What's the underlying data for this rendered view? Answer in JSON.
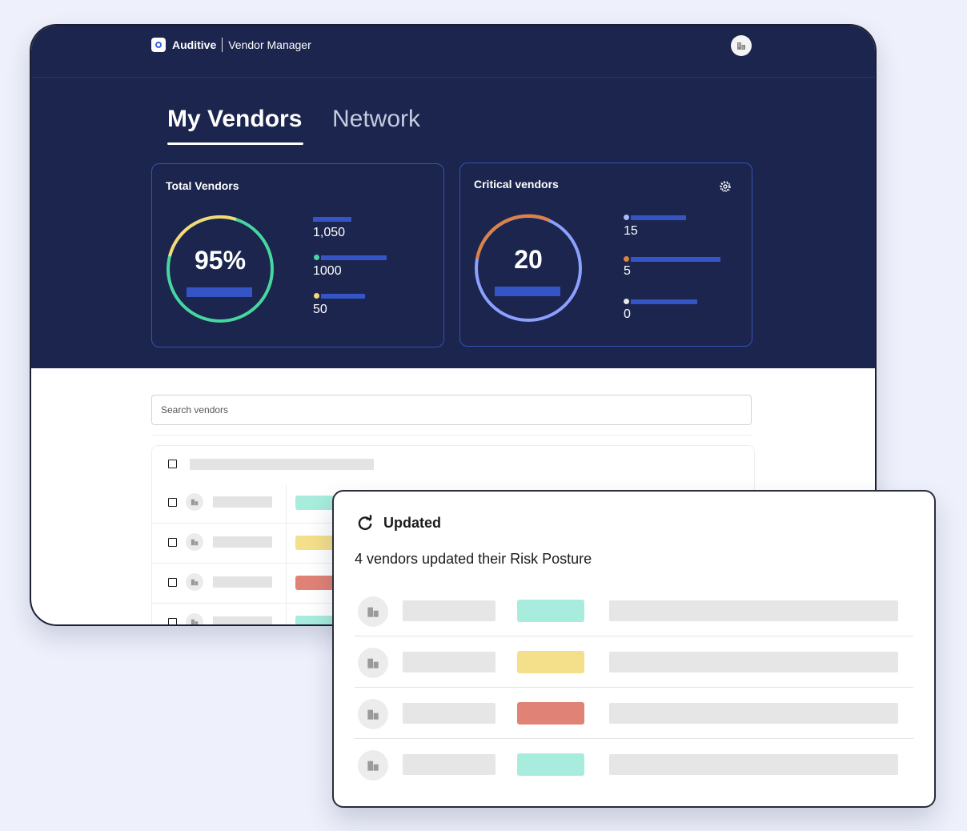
{
  "header": {
    "brand": "Auditive",
    "product": "Vendor Manager"
  },
  "tabs": [
    {
      "label": "My Vendors",
      "active": true
    },
    {
      "label": "Network",
      "active": false
    }
  ],
  "cards": {
    "total": {
      "title": "Total Vendors",
      "percent": "95%",
      "stats": [
        {
          "value": "1,050",
          "dot_color": ""
        },
        {
          "value": "1000",
          "dot_color": "#47d6a0"
        },
        {
          "value": "50",
          "dot_color": "#f4d977"
        }
      ]
    },
    "critical": {
      "title": "Critical vendors",
      "count": "20",
      "stats": [
        {
          "value": "15",
          "dot_color": "#a9b8ff"
        },
        {
          "value": "5",
          "dot_color": "#e08142"
        },
        {
          "value": "0",
          "dot_color": "#e8e8e8"
        }
      ]
    }
  },
  "search": {
    "placeholder": "Search vendors"
  },
  "table": {
    "row_status_colors": [
      "#a7ecdc",
      "#f4df8b",
      "#e08275",
      "#a7ecdc"
    ]
  },
  "popup": {
    "title": "Updated",
    "subtitle": "4 vendors updated their Risk Posture",
    "row_status_colors": [
      "#a7ecdc",
      "#f4df8b",
      "#e08275",
      "#a7ecdc"
    ]
  },
  "colors": {
    "navy": "#1b254d",
    "accent_blue": "#3555c7",
    "ring_green": "#47d6a0",
    "ring_yellow": "#f4d977",
    "ring_orange": "#e08142",
    "ring_blue": "#8ba0ff"
  },
  "icons": {
    "brand": "target-icon",
    "avatar": "building-icon",
    "settings": "gear-icon",
    "refresh": "refresh-icon"
  }
}
